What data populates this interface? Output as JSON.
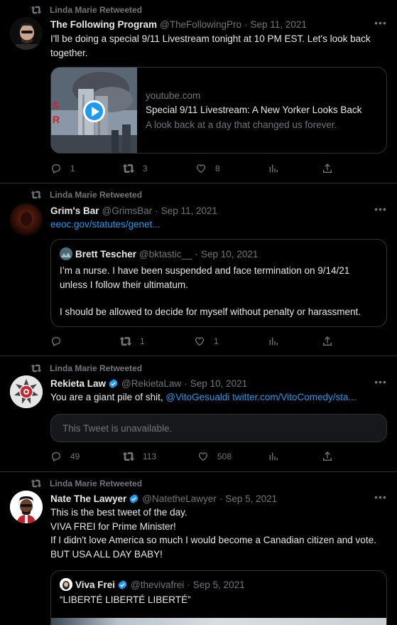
{
  "tweets": [
    {
      "retweeted_by": "Linda Marie Retweeted",
      "name": "The Following Program",
      "handle": "@TheFollowingPro",
      "date": "Sep 11, 2021",
      "text": "I'll be doing a special 9/11 Livestream tonight at 10 PM EST.  Let's look back together.",
      "card": {
        "domain": "youtube.com",
        "title": "Special 9/11 Livestream: A New Yorker Looks Back",
        "description": "A look back at a day that changed us forever."
      },
      "replies": "1",
      "retweets": "3",
      "likes": "8"
    },
    {
      "retweeted_by": "Linda Marie Retweeted",
      "name": "Grim's Bar",
      "handle": "@GrimsBar",
      "date": "Sep 11, 2021",
      "link": "eeoc.gov/statutes/genet...",
      "quote": {
        "name": "Brett Tescher",
        "handle": "@bktastic__",
        "date": "Sep 10, 2021",
        "text1": "I’m a nurse.  I have been suspended and face termination on 9/14/21 unless I follow their ultimatum.",
        "text2": "I should be allowed to decide for myself without penalty or harassment."
      },
      "replies": "",
      "retweets": "1",
      "likes": "1"
    },
    {
      "retweeted_by": "Linda Marie Retweeted",
      "name": "Rekieta Law",
      "handle": "@RekietaLaw",
      "date": "Sep 10, 2021",
      "text": "You are a giant pile of shit, ",
      "mention": "@VitoGesualdi",
      "link": "twitter.com/VitoComedy/sta...",
      "unavailable": "This Tweet is unavailable.",
      "replies": "49",
      "retweets": "113",
      "likes": "508"
    },
    {
      "retweeted_by": "Linda Marie Retweeted",
      "name": "Nate The Lawyer",
      "handle": "@NatetheLawyer",
      "date": "Sep 5, 2021",
      "line1": "This is the best tweet of the day.",
      "line2": "VIVA FREI for Prime Minister!",
      "line3": "If I didn't love America so much I would become a Canadian citizen and vote.",
      "line4": "BUT USA ALL DAY BABY!",
      "quote": {
        "name": "Viva Frei",
        "handle": "@thevivafrei",
        "date": "Sep 5, 2021",
        "text": "“LIBERTÉ LIBERTÉ LIBERTÉ”"
      }
    }
  ],
  "separator": "·",
  "icons": [
    "retweet-icon",
    "reply-icon",
    "like-icon",
    "analytics-icon",
    "share-icon",
    "more-icon",
    "verified-icon",
    "play-icon"
  ],
  "colors": {
    "accent": "#1d9bf0",
    "background": "#000000",
    "muted": "#71767b",
    "border": "#2f3336"
  }
}
